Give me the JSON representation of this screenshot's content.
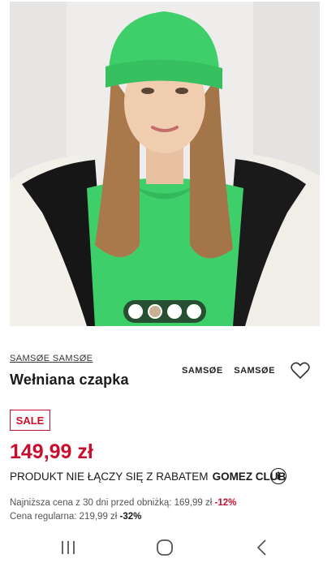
{
  "product": {
    "image_alt": "Model wearing green wool beanie",
    "gallery_count": 4,
    "brand_link": "SAMSØE SAMSØE",
    "title": "Wełniana czapka",
    "brand_logo": "SAMSØE SAMSØE",
    "wishlist_icon": "heart-icon"
  },
  "pricing": {
    "badge": "SALE",
    "price": "149,99 zł",
    "promo_text": "PRODUKT NIE ŁĄCZY SIĘ Z RABATEM",
    "promo_club": "GOMEZ CLUB",
    "info_icon": "i",
    "lowest_label": "Najniższa cena z 30 dni przed obniżką: 169,99 zł",
    "lowest_discount": "-12%",
    "regular_label": "Cena regularna: 219,99 zł",
    "regular_discount": "-32%"
  },
  "colors": {
    "accent_red": "#c8102e",
    "beanie_green": "#3fcf6a"
  },
  "navbar": {
    "recents_icon": "recents-icon",
    "home_icon": "home-icon",
    "back_icon": "back-icon"
  }
}
